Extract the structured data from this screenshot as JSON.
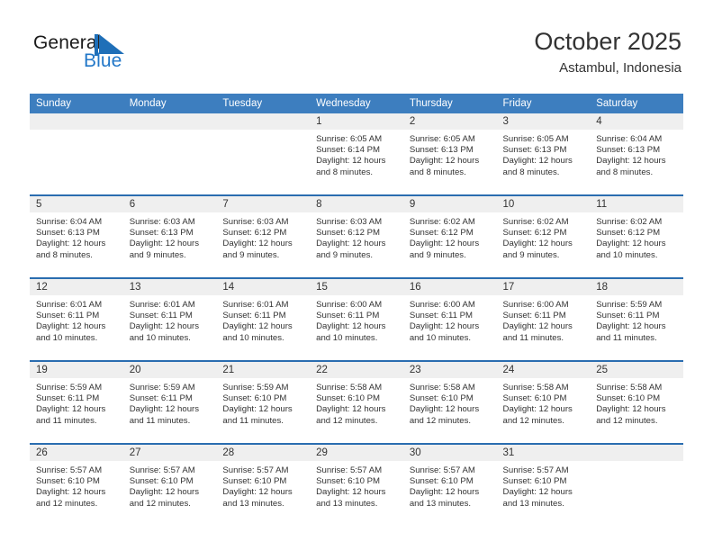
{
  "brand": {
    "name_part1": "General",
    "name_part2": "Blue",
    "mark_icon": "blue-triangle-flag-icon",
    "accent_color": "#2277c8"
  },
  "header": {
    "title": "October 2025",
    "subtitle": "Astambul, Indonesia"
  },
  "theme": {
    "header_bar_color": "#3d7ebf",
    "row_divider_color": "#2a6db0",
    "day_band_color": "#efefef",
    "text_color": "#333333"
  },
  "weekdays": [
    "Sunday",
    "Monday",
    "Tuesday",
    "Wednesday",
    "Thursday",
    "Friday",
    "Saturday"
  ],
  "weeks": [
    [
      {
        "day": "",
        "empty": true
      },
      {
        "day": "",
        "empty": true
      },
      {
        "day": "",
        "empty": true
      },
      {
        "day": "1",
        "sunrise": "Sunrise: 6:05 AM",
        "sunset": "Sunset: 6:14 PM",
        "daylight": "Daylight: 12 hours and 8 minutes."
      },
      {
        "day": "2",
        "sunrise": "Sunrise: 6:05 AM",
        "sunset": "Sunset: 6:13 PM",
        "daylight": "Daylight: 12 hours and 8 minutes."
      },
      {
        "day": "3",
        "sunrise": "Sunrise: 6:05 AM",
        "sunset": "Sunset: 6:13 PM",
        "daylight": "Daylight: 12 hours and 8 minutes."
      },
      {
        "day": "4",
        "sunrise": "Sunrise: 6:04 AM",
        "sunset": "Sunset: 6:13 PM",
        "daylight": "Daylight: 12 hours and 8 minutes."
      }
    ],
    [
      {
        "day": "5",
        "sunrise": "Sunrise: 6:04 AM",
        "sunset": "Sunset: 6:13 PM",
        "daylight": "Daylight: 12 hours and 8 minutes."
      },
      {
        "day": "6",
        "sunrise": "Sunrise: 6:03 AM",
        "sunset": "Sunset: 6:13 PM",
        "daylight": "Daylight: 12 hours and 9 minutes."
      },
      {
        "day": "7",
        "sunrise": "Sunrise: 6:03 AM",
        "sunset": "Sunset: 6:12 PM",
        "daylight": "Daylight: 12 hours and 9 minutes."
      },
      {
        "day": "8",
        "sunrise": "Sunrise: 6:03 AM",
        "sunset": "Sunset: 6:12 PM",
        "daylight": "Daylight: 12 hours and 9 minutes."
      },
      {
        "day": "9",
        "sunrise": "Sunrise: 6:02 AM",
        "sunset": "Sunset: 6:12 PM",
        "daylight": "Daylight: 12 hours and 9 minutes."
      },
      {
        "day": "10",
        "sunrise": "Sunrise: 6:02 AM",
        "sunset": "Sunset: 6:12 PM",
        "daylight": "Daylight: 12 hours and 9 minutes."
      },
      {
        "day": "11",
        "sunrise": "Sunrise: 6:02 AM",
        "sunset": "Sunset: 6:12 PM",
        "daylight": "Daylight: 12 hours and 10 minutes."
      }
    ],
    [
      {
        "day": "12",
        "sunrise": "Sunrise: 6:01 AM",
        "sunset": "Sunset: 6:11 PM",
        "daylight": "Daylight: 12 hours and 10 minutes."
      },
      {
        "day": "13",
        "sunrise": "Sunrise: 6:01 AM",
        "sunset": "Sunset: 6:11 PM",
        "daylight": "Daylight: 12 hours and 10 minutes."
      },
      {
        "day": "14",
        "sunrise": "Sunrise: 6:01 AM",
        "sunset": "Sunset: 6:11 PM",
        "daylight": "Daylight: 12 hours and 10 minutes."
      },
      {
        "day": "15",
        "sunrise": "Sunrise: 6:00 AM",
        "sunset": "Sunset: 6:11 PM",
        "daylight": "Daylight: 12 hours and 10 minutes."
      },
      {
        "day": "16",
        "sunrise": "Sunrise: 6:00 AM",
        "sunset": "Sunset: 6:11 PM",
        "daylight": "Daylight: 12 hours and 10 minutes."
      },
      {
        "day": "17",
        "sunrise": "Sunrise: 6:00 AM",
        "sunset": "Sunset: 6:11 PM",
        "daylight": "Daylight: 12 hours and 11 minutes."
      },
      {
        "day": "18",
        "sunrise": "Sunrise: 5:59 AM",
        "sunset": "Sunset: 6:11 PM",
        "daylight": "Daylight: 12 hours and 11 minutes."
      }
    ],
    [
      {
        "day": "19",
        "sunrise": "Sunrise: 5:59 AM",
        "sunset": "Sunset: 6:11 PM",
        "daylight": "Daylight: 12 hours and 11 minutes."
      },
      {
        "day": "20",
        "sunrise": "Sunrise: 5:59 AM",
        "sunset": "Sunset: 6:11 PM",
        "daylight": "Daylight: 12 hours and 11 minutes."
      },
      {
        "day": "21",
        "sunrise": "Sunrise: 5:59 AM",
        "sunset": "Sunset: 6:10 PM",
        "daylight": "Daylight: 12 hours and 11 minutes."
      },
      {
        "day": "22",
        "sunrise": "Sunrise: 5:58 AM",
        "sunset": "Sunset: 6:10 PM",
        "daylight": "Daylight: 12 hours and 12 minutes."
      },
      {
        "day": "23",
        "sunrise": "Sunrise: 5:58 AM",
        "sunset": "Sunset: 6:10 PM",
        "daylight": "Daylight: 12 hours and 12 minutes."
      },
      {
        "day": "24",
        "sunrise": "Sunrise: 5:58 AM",
        "sunset": "Sunset: 6:10 PM",
        "daylight": "Daylight: 12 hours and 12 minutes."
      },
      {
        "day": "25",
        "sunrise": "Sunrise: 5:58 AM",
        "sunset": "Sunset: 6:10 PM",
        "daylight": "Daylight: 12 hours and 12 minutes."
      }
    ],
    [
      {
        "day": "26",
        "sunrise": "Sunrise: 5:57 AM",
        "sunset": "Sunset: 6:10 PM",
        "daylight": "Daylight: 12 hours and 12 minutes."
      },
      {
        "day": "27",
        "sunrise": "Sunrise: 5:57 AM",
        "sunset": "Sunset: 6:10 PM",
        "daylight": "Daylight: 12 hours and 12 minutes."
      },
      {
        "day": "28",
        "sunrise": "Sunrise: 5:57 AM",
        "sunset": "Sunset: 6:10 PM",
        "daylight": "Daylight: 12 hours and 13 minutes."
      },
      {
        "day": "29",
        "sunrise": "Sunrise: 5:57 AM",
        "sunset": "Sunset: 6:10 PM",
        "daylight": "Daylight: 12 hours and 13 minutes."
      },
      {
        "day": "30",
        "sunrise": "Sunrise: 5:57 AM",
        "sunset": "Sunset: 6:10 PM",
        "daylight": "Daylight: 12 hours and 13 minutes."
      },
      {
        "day": "31",
        "sunrise": "Sunrise: 5:57 AM",
        "sunset": "Sunset: 6:10 PM",
        "daylight": "Daylight: 12 hours and 13 minutes."
      },
      {
        "day": "",
        "empty": true
      }
    ]
  ]
}
